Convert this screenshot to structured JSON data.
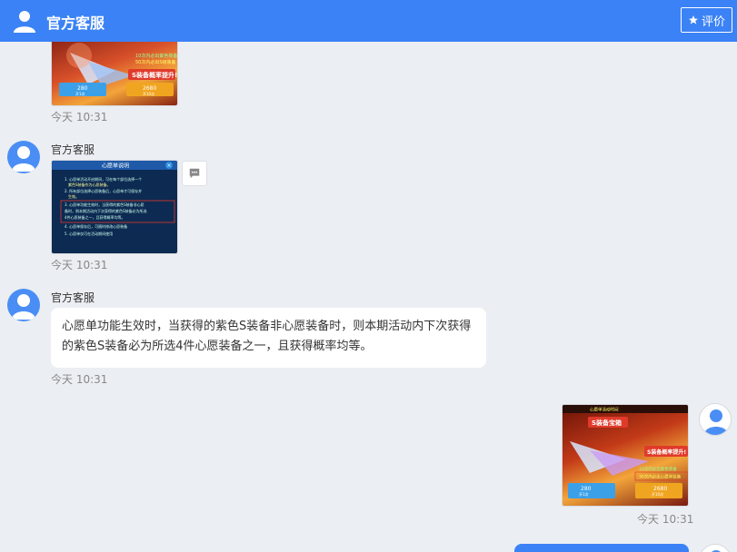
{
  "header": {
    "title": "官方客服",
    "rate_label": "评价",
    "bg_color": "#3b82f6"
  },
  "messages": [
    {
      "sender": "",
      "type": "image",
      "image_desc": "装备概率提升 活动图",
      "time": "今天 10:31"
    },
    {
      "sender": "官方客服",
      "type": "image",
      "image_desc": "心愿单说明",
      "time": "今天 10:31"
    },
    {
      "sender": "官方客服",
      "type": "text",
      "text": "心愿单功能生效时，当获得的紫色S装备非心愿装备时，则本期活动内下次获得的紫色S装备必为所选4件心愿装备之一，且获得概率均等。",
      "time": "今天 10:31"
    },
    {
      "sender": "",
      "type": "image",
      "image_desc": "S装备宝箱 活动图",
      "time": "今天 10:31"
    }
  ],
  "img1": {
    "price_a": "280",
    "price_b": "2680",
    "label_a": "开1次",
    "label_b": "开10次",
    "banner": "S装备概率提升!"
  },
  "img2": {
    "title": "心愿单说明",
    "lines": [
      "1. 心愿单活动开启期间，可在每个部位选择一个",
      "紫色S装备作为心愿装备。",
      "2. 所有部位选择心愿装备后，心愿单才可保存并",
      "生效。",
      "3. 心愿单功能生效时，当获得的紫色S装备非心愿",
      "备时，则本期活动内下次获得的紫色S装备必为所选",
      "4件心愿装备之一，且获得概率均等。",
      "4. 心愿单保存后，可随时修改心愿装备",
      "5. 心愿单仅可在活动期间使用"
    ]
  },
  "img3": {
    "top_text": "心愿单活动时间",
    "banner": "S装备宝箱",
    "sub": "S装备概率提升!",
    "price_a": "280",
    "price_b": "2680",
    "label_a": "开1次",
    "label_b": "开10次",
    "line1": "10次内必出紫色装备",
    "line2": "30次内必出心愿单装备"
  }
}
